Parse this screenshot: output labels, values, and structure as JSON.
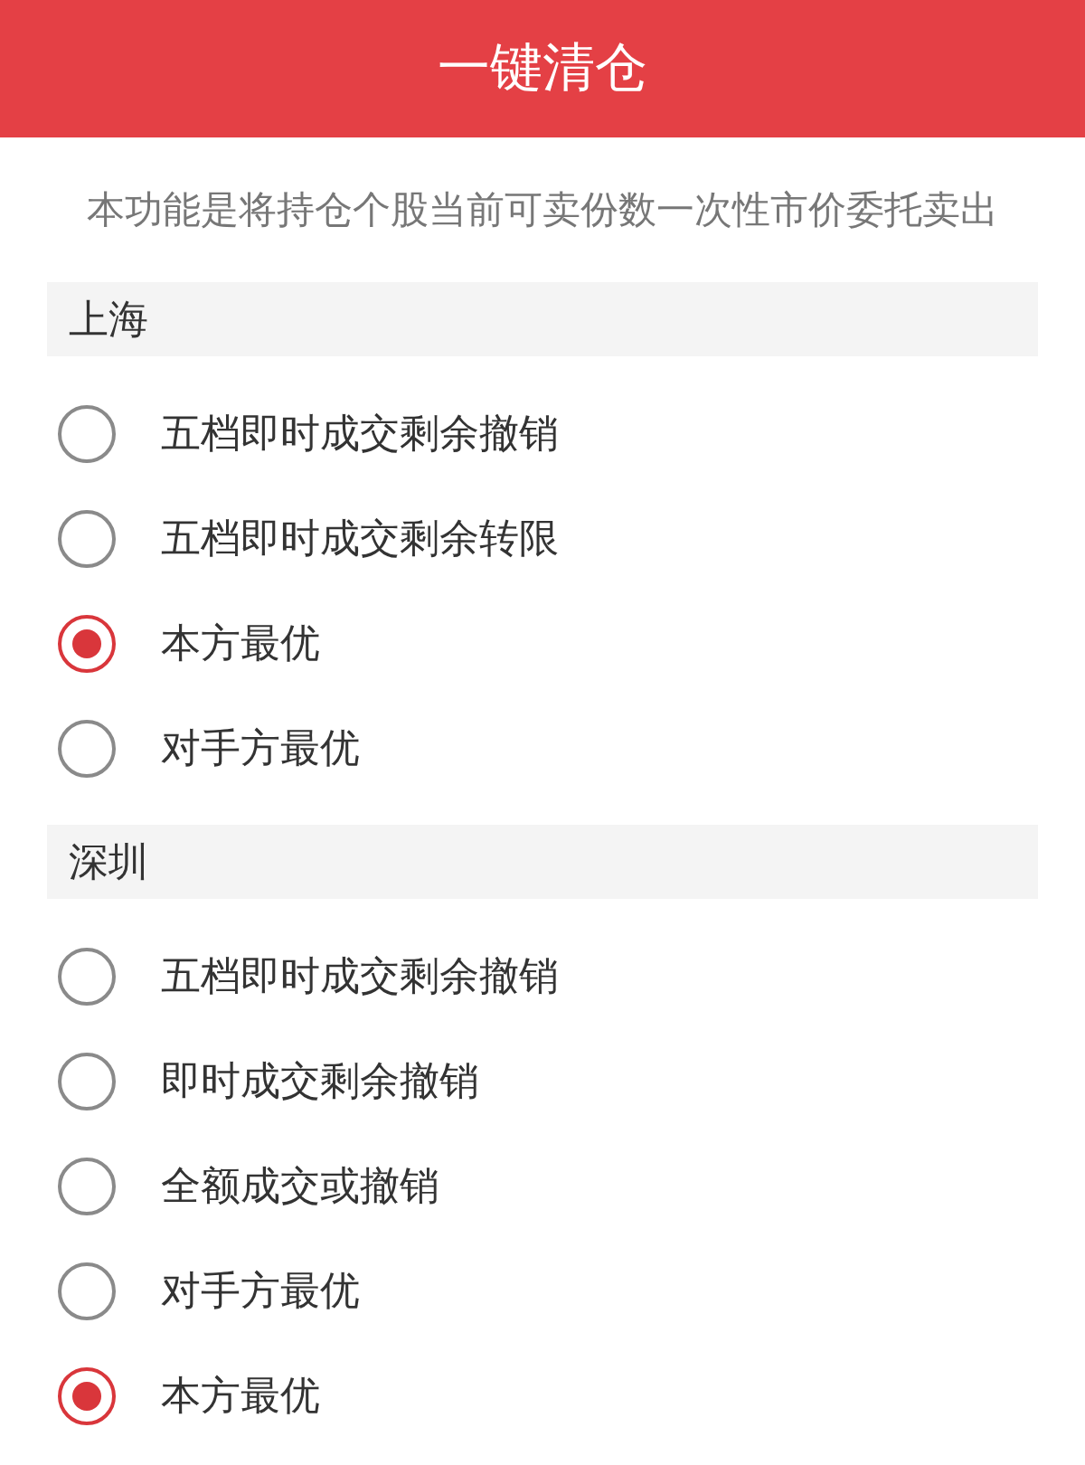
{
  "header": {
    "title": "一键清仓"
  },
  "description": "本功能是将持仓个股当前可卖份数一次性市价委托卖出",
  "sections": [
    {
      "title": "上海",
      "options": [
        {
          "label": "五档即时成交剩余撤销",
          "selected": false
        },
        {
          "label": "五档即时成交剩余转限",
          "selected": false
        },
        {
          "label": "本方最优",
          "selected": true
        },
        {
          "label": "对手方最优",
          "selected": false
        }
      ]
    },
    {
      "title": "深圳",
      "options": [
        {
          "label": "五档即时成交剩余撤销",
          "selected": false
        },
        {
          "label": "即时成交剩余撤销",
          "selected": false
        },
        {
          "label": "全额成交或撤销",
          "selected": false
        },
        {
          "label": "对手方最优",
          "selected": false
        },
        {
          "label": "本方最优",
          "selected": true
        }
      ]
    }
  ]
}
